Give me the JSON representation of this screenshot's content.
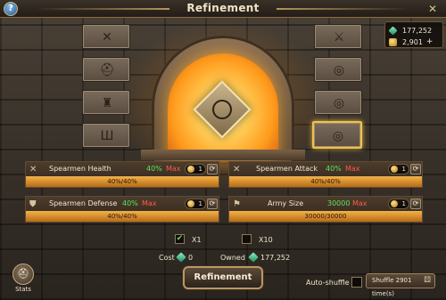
{
  "window": {
    "title": "Refinement"
  },
  "resources": {
    "gems": "177,252",
    "coins": "2,901",
    "plus_label": "+"
  },
  "slots": {
    "left": [
      {
        "icon": "crossed-swords-icon",
        "glyph": "✕"
      },
      {
        "icon": "helmet-icon",
        "glyph": "⛑"
      },
      {
        "icon": "armor-icon",
        "glyph": "♜"
      },
      {
        "icon": "boots-icon",
        "glyph": "Ш"
      }
    ],
    "right": [
      {
        "icon": "scroll-icon",
        "glyph": "⚔"
      },
      {
        "icon": "emblem-icon",
        "glyph": "◎"
      },
      {
        "icon": "emblem-icon",
        "glyph": "◎"
      },
      {
        "icon": "emblem-icon",
        "glyph": "◎",
        "selected": true
      }
    ]
  },
  "stats": [
    {
      "name": "Spearmen Health",
      "value": "40%",
      "max": "Max",
      "lock_count": "1",
      "bar_text": "40%/40%",
      "progress": 1.0
    },
    {
      "name": "Spearmen Attack",
      "value": "40%",
      "max": "Max",
      "lock_count": "1",
      "bar_text": "40%/40%",
      "progress": 1.0
    },
    {
      "name": "Spearmen Defense",
      "value": "40%",
      "max": "Max",
      "lock_count": "1",
      "bar_text": "40%/40%",
      "progress": 1.0
    },
    {
      "name": "Army Size",
      "value": "30000",
      "max": "Max",
      "lock_count": "1",
      "bar_text": "30000/30000",
      "progress": 1.0
    }
  ],
  "options": {
    "x1_label": "X1",
    "x1_checked": true,
    "x10_label": "X10",
    "x10_checked": false
  },
  "cost": {
    "label": "Cost",
    "value": "0"
  },
  "owned": {
    "label": "Owned",
    "value": "177,252"
  },
  "buttons": {
    "refine_label": "Refinement",
    "stats_label": "Stats",
    "auto_shuffle_label": "Auto-shuffle",
    "shuffle_label": "Shuffle 2901 time(s)"
  },
  "colors": {
    "stat_value_green": "#59e45b",
    "max_red": "#ff5a4a",
    "bar_orange": "#f3b24c",
    "selected_gold": "#f1c14a"
  }
}
